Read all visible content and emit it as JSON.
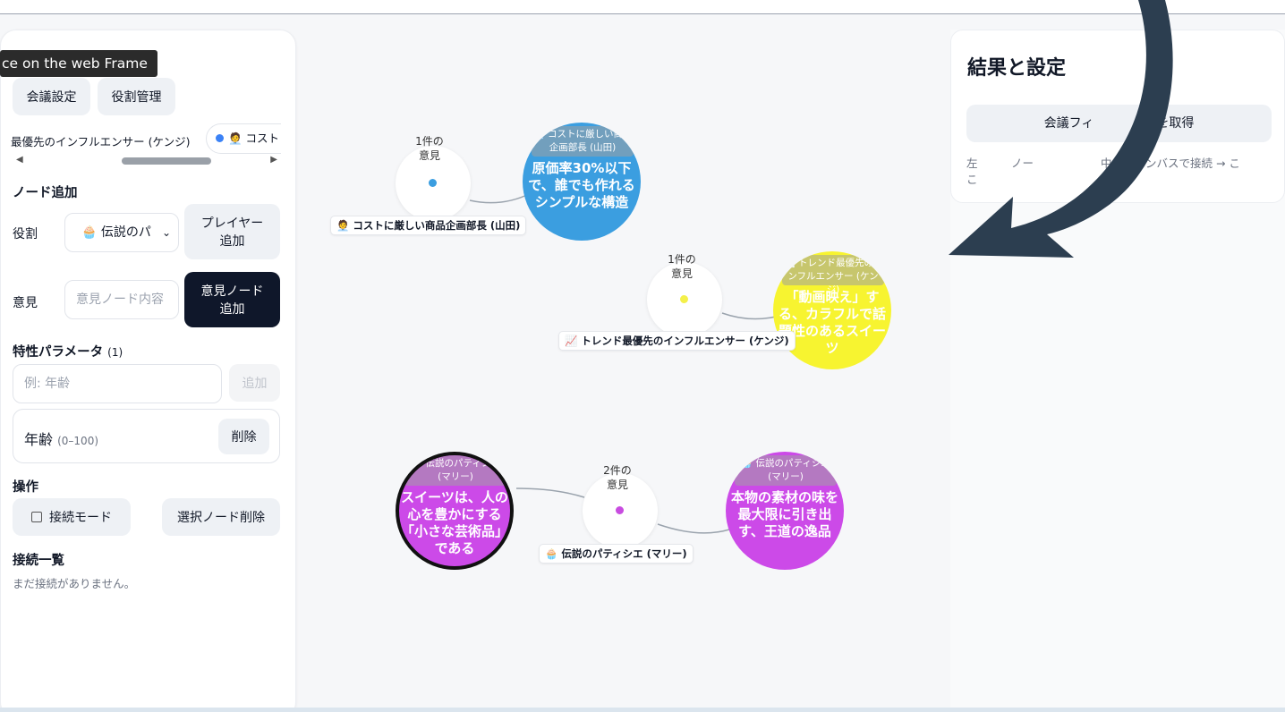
{
  "tooltip": "ce on the web Frame",
  "tabs": [
    "会議設定",
    "役割管理"
  ],
  "roles_strip": {
    "first": "最優先のインフルエンサー (ケンジ)",
    "second": "🧑‍💼 コスト"
  },
  "add_node": {
    "title": "ノード追加",
    "role_label": "役割",
    "role_value": "🧁 伝説のパ",
    "add_player": "プレイヤー\n追加",
    "opinion_label": "意見",
    "opinion_placeholder": "意見ノード内容",
    "add_opinion": "意見ノード\n追加"
  },
  "params": {
    "title": "特性パラメータ",
    "count": "(1)",
    "input_placeholder": "例: 年齢",
    "add": "追加",
    "items": [
      {
        "name": "年齢",
        "range": "(0–100)",
        "delete": "削除"
      }
    ]
  },
  "operations": {
    "title": "操作",
    "connect_mode": "接続モード",
    "delete_selected": "選択ノード削除"
  },
  "connections": {
    "title": "接続一覧",
    "empty": "まだ接続がありません。"
  },
  "canvas": {
    "hubs": [
      {
        "count": "1件の",
        "label": "意見",
        "color": "#3b9ee0"
      },
      {
        "count": "1件の",
        "label": "意見",
        "color": "#f4f04a"
      },
      {
        "count": "2件の",
        "label": "意見",
        "color": "#c84ce0"
      }
    ],
    "opinions": [
      {
        "tag": "🧑‍💼 コストに厳しい商品企画部長 (山田)",
        "text": "原価率30%以下で、誰でも作れるシンプルな構造",
        "color": "#3b9ee0"
      },
      {
        "tag": "📈 トレンド最優先のインフルエンサー (ケンジ)",
        "text": "「動画映え」する、カラフルで話題性のあるスイーツ",
        "color": "#f7f430"
      },
      {
        "tag": "🧁 伝説のパティシエ (マリー)",
        "text": "スイーツは、人の心を豊かにする「小さな芸術品」である",
        "color": "#cc4ae8"
      },
      {
        "tag": "🧁 伝説のパティシエ (マリー)",
        "text": "本物の素材の味を最大限に引き出す、王道の逸品",
        "color": "#cc4ae8"
      }
    ],
    "role_labels": [
      "🧑‍💼 コストに厳しい商品企画部長 (山田)",
      "📈 トレンド最優先のインフルエンサー (ケンジ)",
      "🧁 伝説のパティシエ (マリー)"
    ]
  },
  "right": {
    "title": "結果と設定",
    "feedback_button": "会議フィ　　　　クを取得",
    "hint": "左　　　ノー　　　　　　中央キャンバスで接続 → こ\nこ"
  },
  "colors": {
    "dark": "#0f172a",
    "arrow": "#2c3e50"
  }
}
